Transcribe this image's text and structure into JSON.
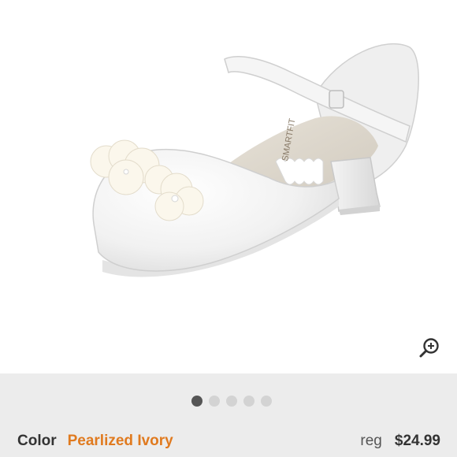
{
  "product": {
    "color_label": "Color",
    "color_value": "Pearlized Ivory",
    "price_label": "reg",
    "price": "$24.99",
    "brand_print": "SMARTFIT"
  },
  "gallery": {
    "image_count": 5,
    "active_index": 0,
    "zoom_icon": "zoom-in-icon"
  },
  "colors": {
    "accent": "#e07a1f",
    "band": "#ececec",
    "dot_active": "#555555",
    "dot_inactive": "#d3d3d3"
  }
}
